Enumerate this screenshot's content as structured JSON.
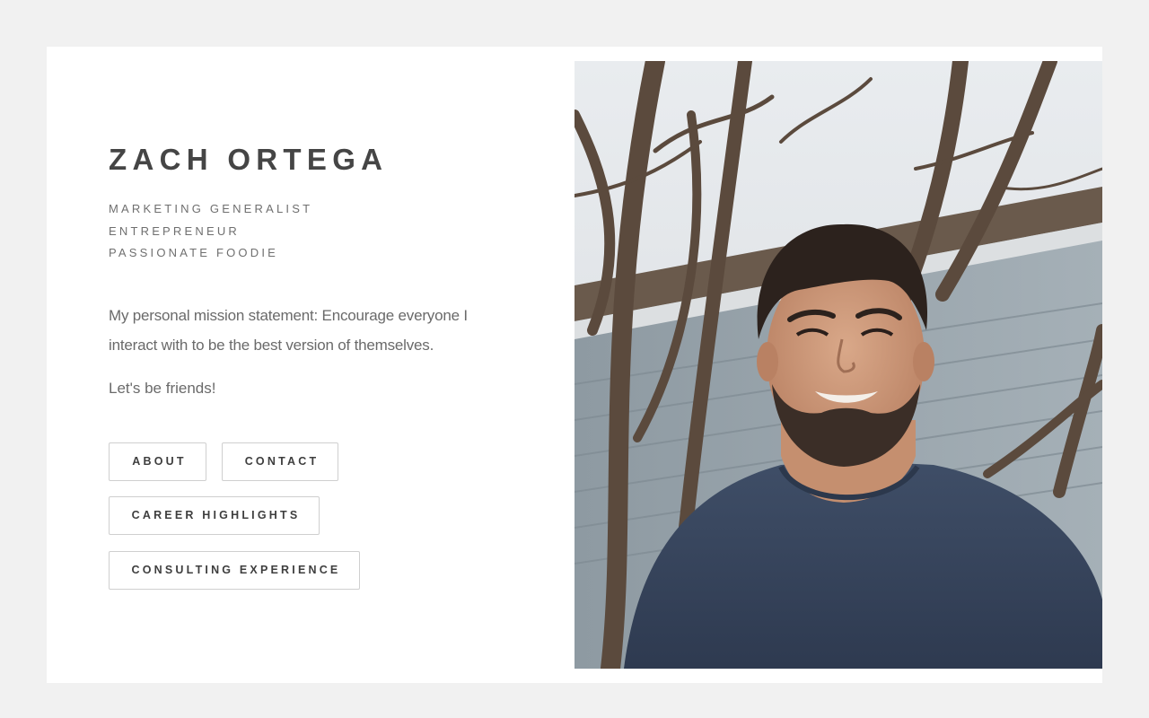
{
  "profile": {
    "name": "ZACH ORTEGA",
    "tags": [
      "MARKETING GENERALIST",
      "ENTREPRENEUR",
      "PASSIONATE FOODIE"
    ],
    "mission": "My personal mission statement: Encourage everyone I interact with to be the best version of themselves.",
    "friends": "Let's be friends!"
  },
  "nav": {
    "about": "ABOUT",
    "contact": "CONTACT",
    "career": "CAREER HIGHLIGHTS",
    "consulting": "CONSULTING EXPERIENCE"
  },
  "colors": {
    "page_bg": "#f1f1f1",
    "card_bg": "#ffffff",
    "heading": "#454545",
    "body_text": "#6a6a6a",
    "button_border": "#cfcfcf"
  }
}
